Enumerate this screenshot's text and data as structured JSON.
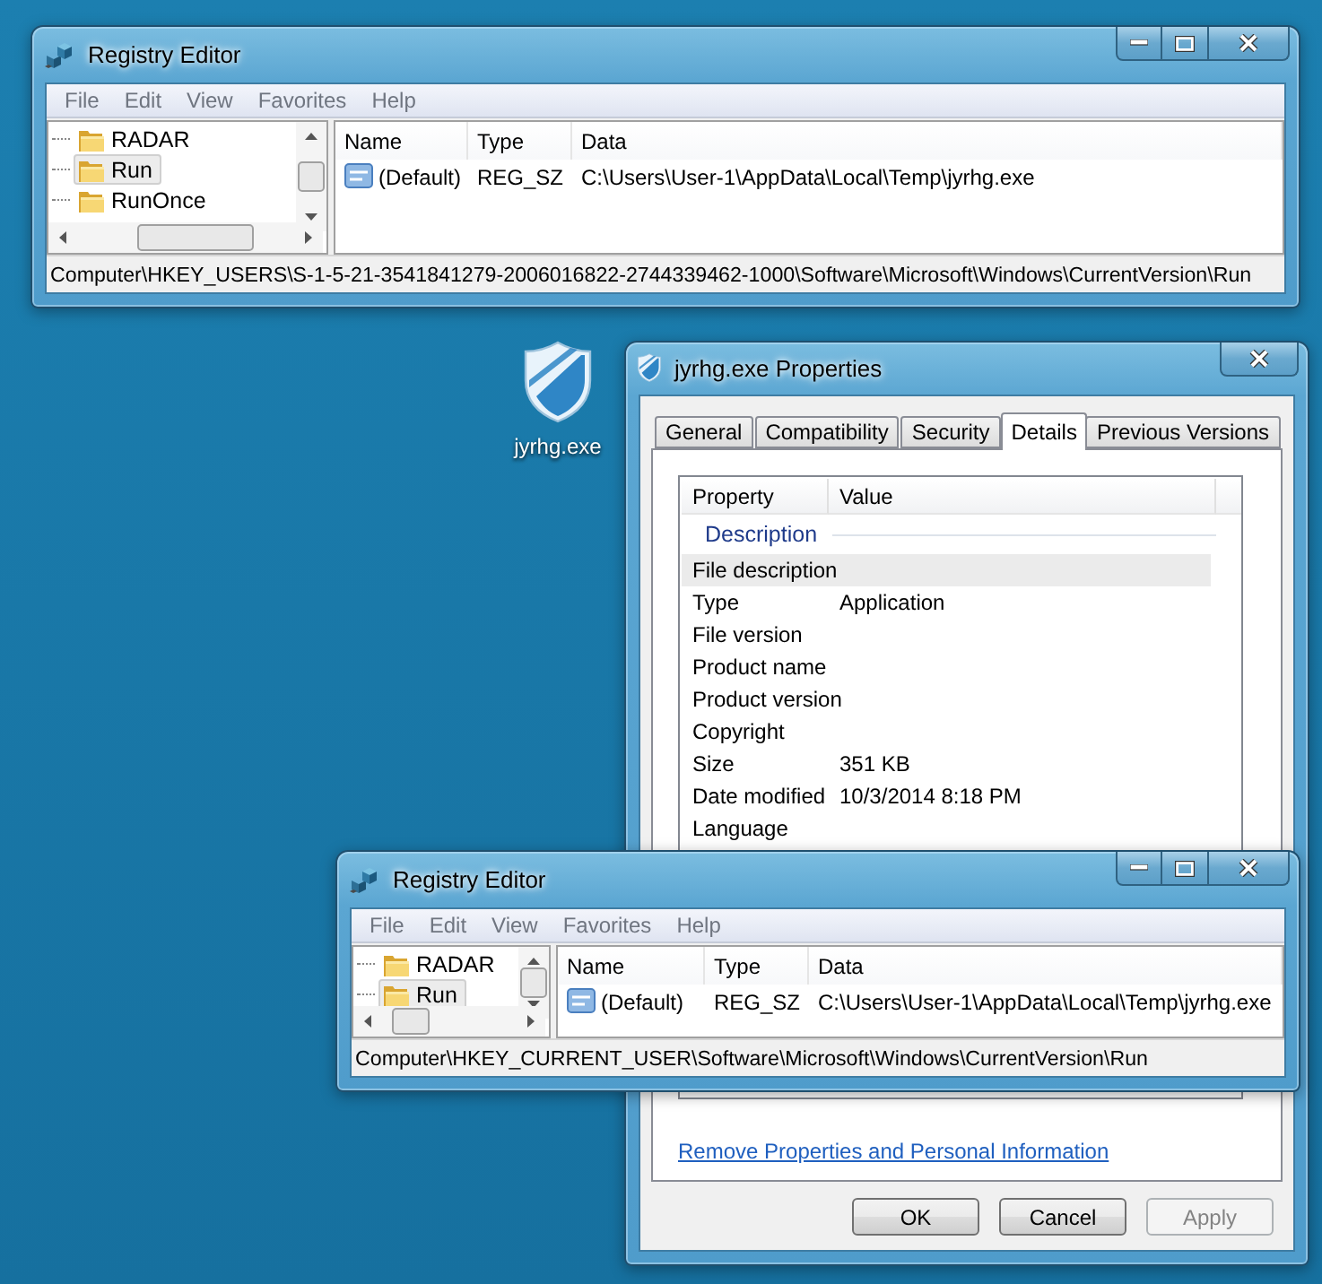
{
  "desktop": {
    "icons": [
      {
        "label": "jyrhg.exe"
      }
    ]
  },
  "windows": [
    {
      "kind": "registry_editor",
      "title": "Registry Editor",
      "menu": [
        "File",
        "Edit",
        "View",
        "Favorites",
        "Help"
      ],
      "tree": [
        {
          "label": "RADAR",
          "selected": false
        },
        {
          "label": "Run",
          "selected": true
        },
        {
          "label": "RunOnce",
          "selected": false
        }
      ],
      "columns": [
        "Name",
        "Type",
        "Data"
      ],
      "rows": [
        {
          "name": "(Default)",
          "type": "REG_SZ",
          "data": "C:\\Users\\User-1\\AppData\\Local\\Temp\\jyrhg.exe"
        }
      ],
      "status_bar": "Computer\\HKEY_USERS\\S-1-5-21-3541841279-2006016822-2744339462-1000\\Software\\Microsoft\\Windows\\CurrentVersion\\Run"
    },
    {
      "kind": "properties",
      "title": "jyrhg.exe Properties",
      "tabs": [
        {
          "label": "General",
          "selected": false
        },
        {
          "label": "Compatibility",
          "selected": false
        },
        {
          "label": "Security",
          "selected": false
        },
        {
          "label": "Details",
          "selected": true
        },
        {
          "label": "Previous Versions",
          "selected": false
        }
      ],
      "columns": [
        "Property",
        "Value"
      ],
      "section": "Description",
      "properties": [
        {
          "name": "File description",
          "selected": true
        },
        {
          "name": "Type",
          "value": "Application",
          "selected": false
        },
        {
          "name": "File version",
          "selected": false
        },
        {
          "name": "Product name",
          "selected": false
        },
        {
          "name": "Product version",
          "selected": false
        },
        {
          "name": "Copyright",
          "selected": false
        },
        {
          "name": "Size",
          "value": "351 KB",
          "selected": false
        },
        {
          "name": "Date modified",
          "value": "10/3/2014 8:18 PM",
          "selected": false
        },
        {
          "name": "Language",
          "selected": false
        }
      ],
      "link": "Remove Properties and Personal Information",
      "buttons": [
        {
          "label": "OK",
          "disabled": false
        },
        {
          "label": "Cancel",
          "disabled": false
        },
        {
          "label": "Apply",
          "disabled": true
        }
      ]
    },
    {
      "kind": "registry_editor",
      "title": "Registry Editor",
      "menu": [
        "File",
        "Edit",
        "View",
        "Favorites",
        "Help"
      ],
      "tree": [
        {
          "label": "RADAR",
          "selected": false
        },
        {
          "label": "Run",
          "selected": true
        }
      ],
      "columns": [
        "Name",
        "Type",
        "Data"
      ],
      "rows": [
        {
          "name": "(Default)",
          "type": "REG_SZ",
          "data": "C:\\Users\\User-1\\AppData\\Local\\Temp\\jyrhg.exe"
        }
      ],
      "status_bar": "Computer\\HKEY_CURRENT_USER\\Software\\Microsoft\\Windows\\CurrentVersion\\Run"
    }
  ]
}
